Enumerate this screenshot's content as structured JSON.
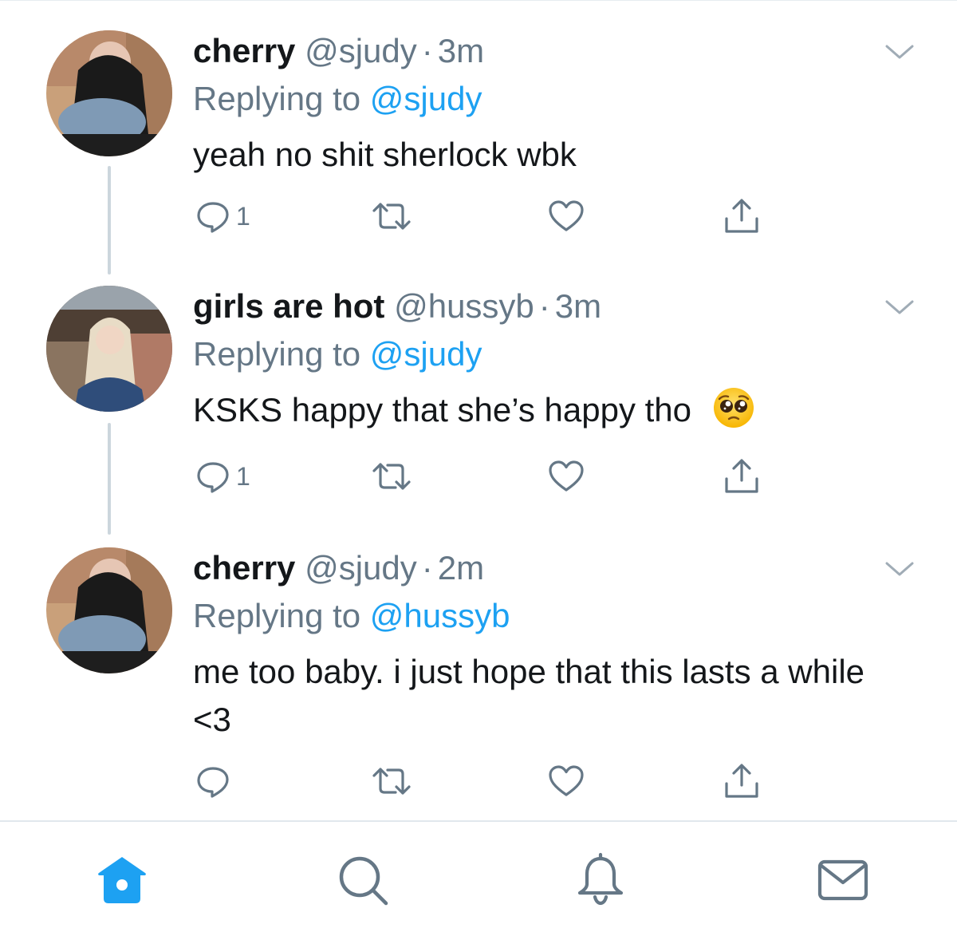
{
  "theme": {
    "accent": "#1da1f2",
    "text_primary": "#14171a",
    "text_secondary": "#657786",
    "icon_gray": "#657786",
    "thread_line": "#ccd6dd"
  },
  "tweets": [
    {
      "name": "cherry",
      "handle": "@sjudy",
      "dot": "·",
      "time": "3m",
      "reply_prefix": "Replying to",
      "reply_to": "@sjudy",
      "text": "yeah no shit sherlock wbk",
      "reply_count": "1",
      "emoji": ""
    },
    {
      "name": "girls are hot",
      "handle": "@hussyb",
      "dot": "·",
      "time": "3m",
      "reply_prefix": "Replying to",
      "reply_to": "@sjudy",
      "text": "KSKS happy that she’s happy tho",
      "reply_count": "1",
      "emoji": "pleading-face-emoji"
    },
    {
      "name": "cherry",
      "handle": "@sjudy",
      "dot": "·",
      "time": "2m",
      "reply_prefix": "Replying to",
      "reply_to": "@hussyb",
      "text": "me too baby. i just hope that this lasts a while <3",
      "reply_count": "",
      "emoji": ""
    }
  ],
  "tabbar": {
    "items": [
      {
        "icon": "home-icon",
        "active": true
      },
      {
        "icon": "search-icon",
        "active": false
      },
      {
        "icon": "bell-icon",
        "active": false
      },
      {
        "icon": "mail-icon",
        "active": false
      }
    ]
  }
}
